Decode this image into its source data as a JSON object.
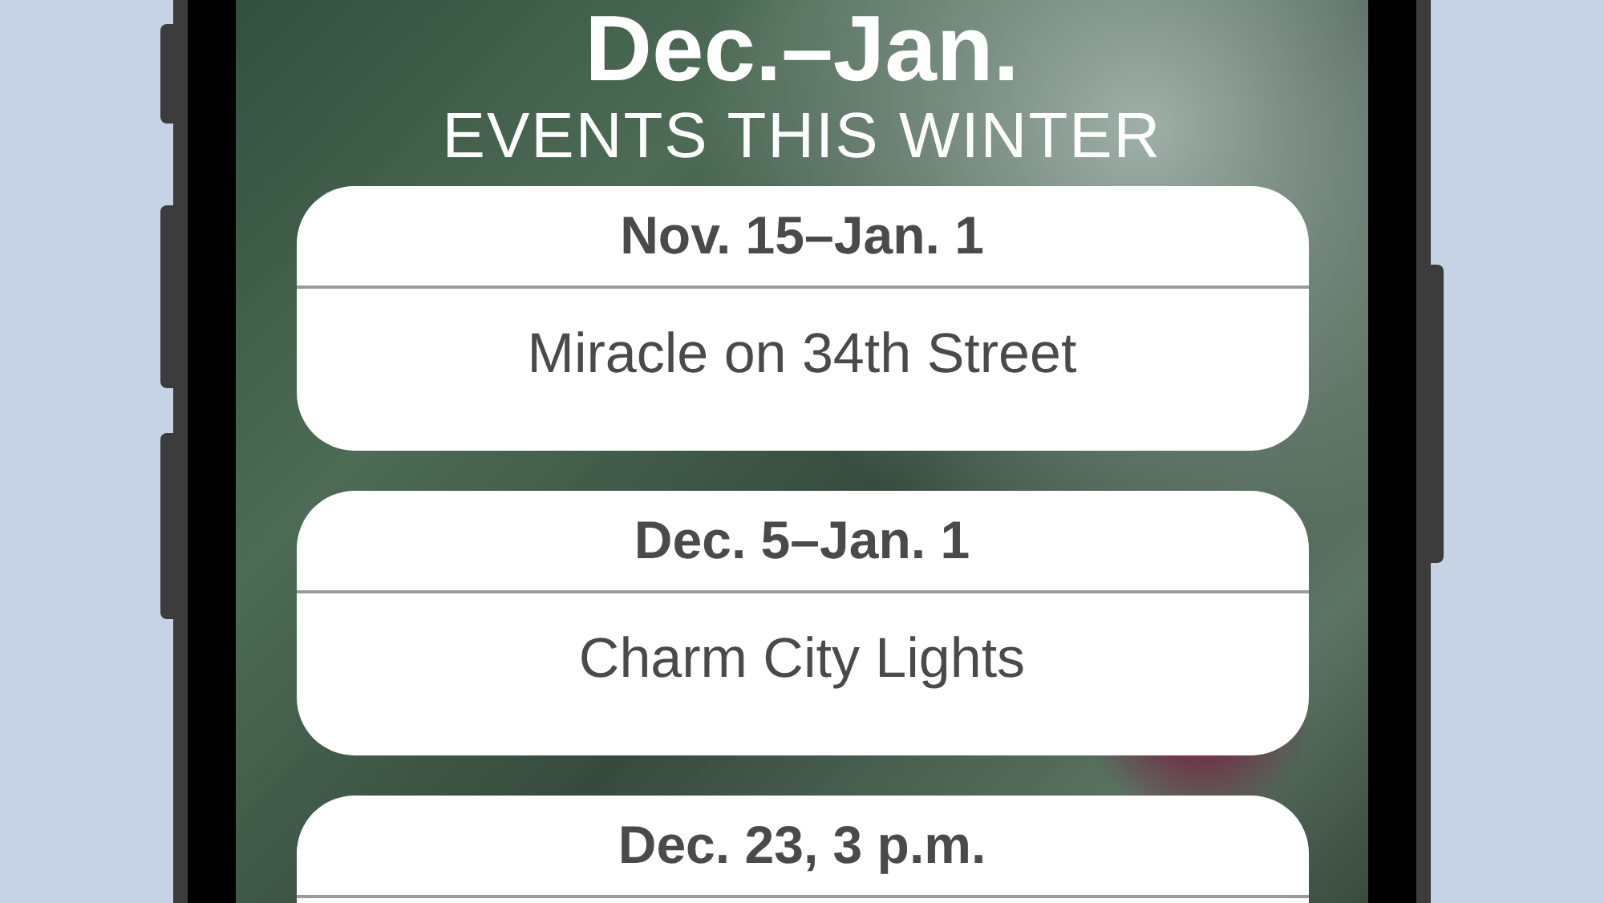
{
  "title": "Dec.–Jan.",
  "subtitle": "EVENTS THIS WINTER",
  "events": [
    {
      "date": "Nov. 15–Jan. 1",
      "name": "Miracle on 34th Street"
    },
    {
      "date": "Dec. 5–Jan. 1",
      "name": "Charm City Lights"
    },
    {
      "date": "Dec. 23, 3 p.m."
    }
  ]
}
